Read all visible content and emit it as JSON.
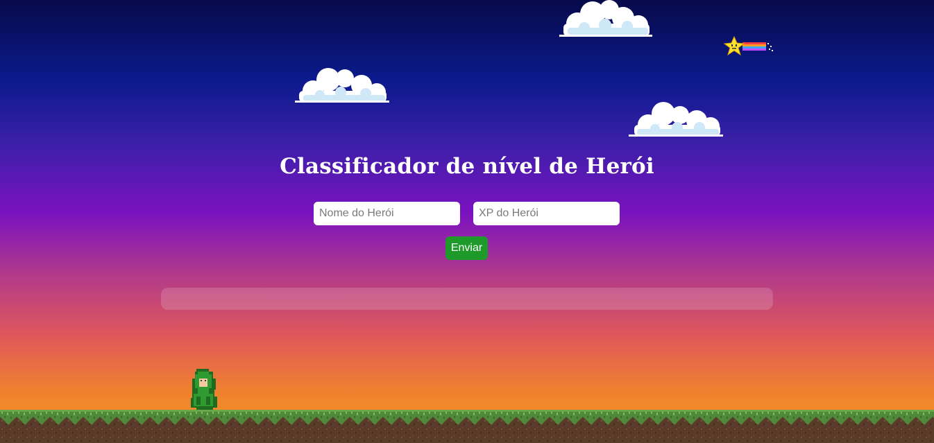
{
  "page": {
    "title": "Classificador de nível de Herói"
  },
  "form": {
    "name_placeholder": "Nome do Herói",
    "xp_placeholder": "XP do Herói",
    "submit_label": "Enviar"
  },
  "result": {
    "text": ""
  },
  "scene": {
    "sky_top_color": "#070a4a",
    "sky_mid_color": "#7a12c0",
    "sky_bottom_color": "#f59a1e",
    "button_color": "#1e9a2a",
    "decorations": [
      "cloud-icon",
      "cloud-icon",
      "cloud-icon",
      "shooting-star-icon",
      "hero-sprite-icon",
      "grass-ground"
    ]
  }
}
